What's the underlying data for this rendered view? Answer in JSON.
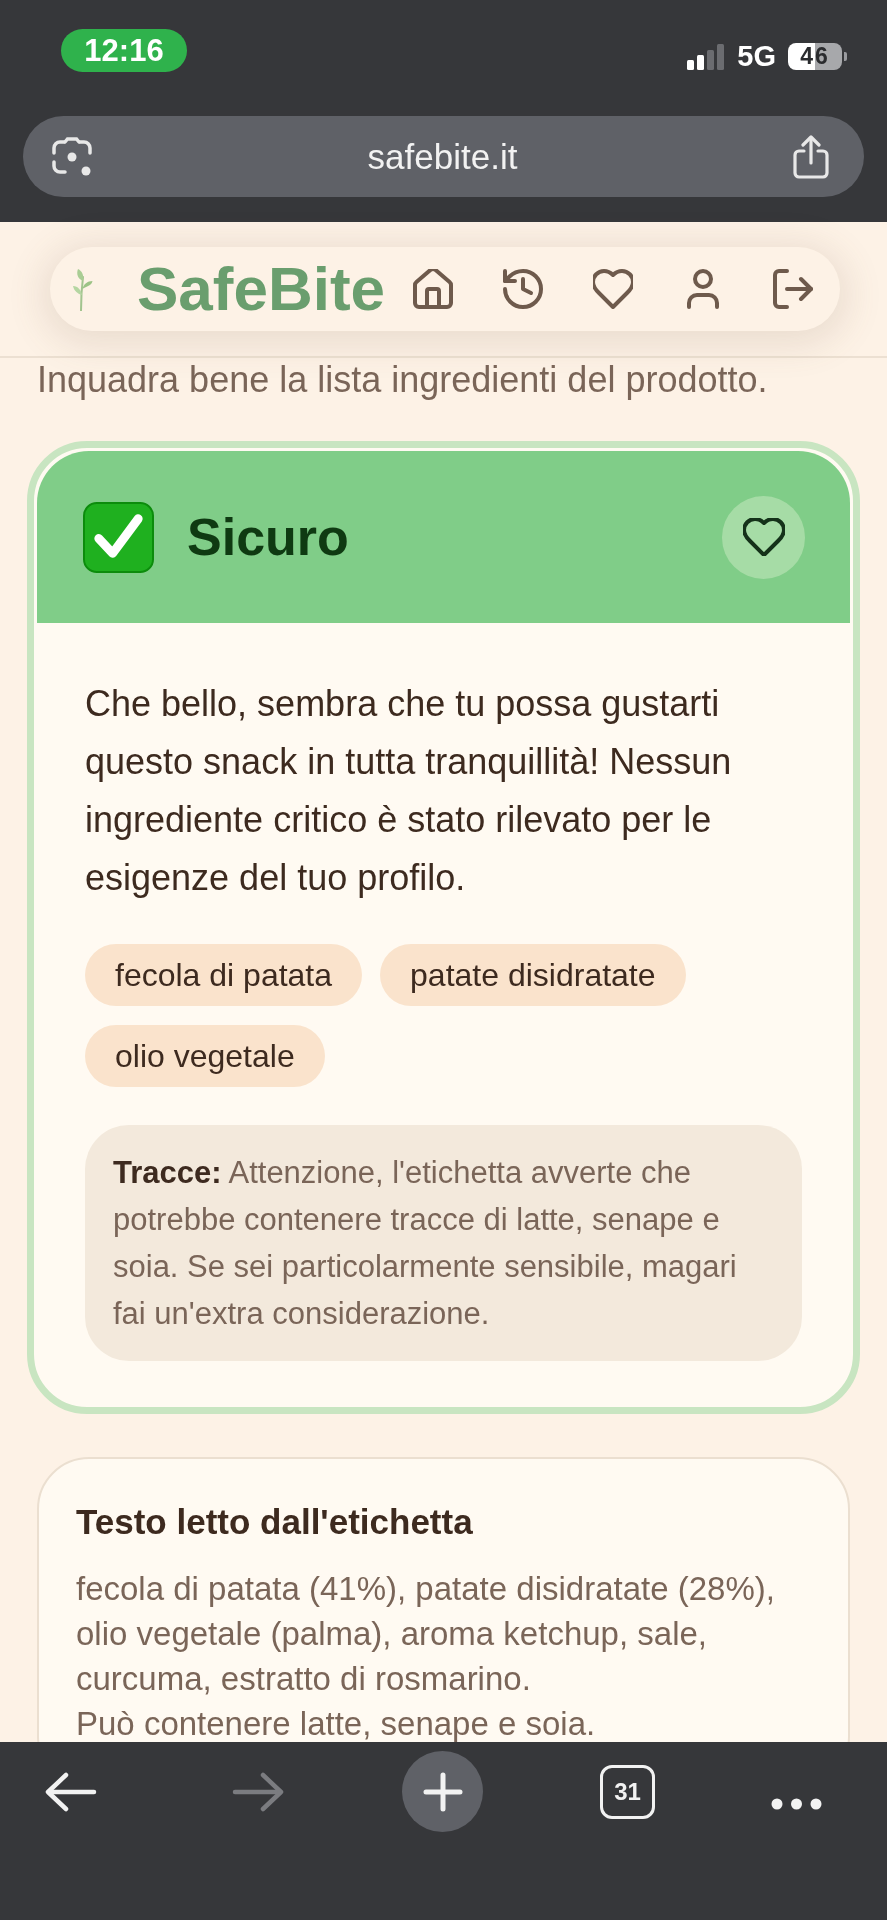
{
  "status_bar": {
    "time": "12:16",
    "network": "5G",
    "battery": "46"
  },
  "address_bar": {
    "url": "safebite.it"
  },
  "header": {
    "brand": "SafeBite"
  },
  "instruction": "Inquadra bene la lista ingredienti del prodotto.",
  "result": {
    "kind": "safe",
    "title": "Sicuro",
    "favorite": false,
    "message": "Che bello, sembra che tu possa gustarti questo snack in tutta tranquillità! Nessun ingrediente critico è stato rilevato per le esigenze del tuo profilo.",
    "ingredients": [
      "fecola di patata",
      "patate disidratate",
      "olio vegetale"
    ],
    "traces": "**Tracce:** Attenzione, l'etichetta avverte che potrebbe contenere tracce di latte, senape e soia. Se sei particolarmente sensibile, magari fai un'extra considerazione."
  },
  "label_text": {
    "title": "Testo letto dall'etichetta",
    "paragraphs": [
      "fecola di patata (41%), patate disidratate (28%), olio vegetale (palma), aroma ketchup, sale, curcuma, estratto di rosmarino.",
      "Può contenere latte, senape e soia."
    ]
  },
  "toolbar": {
    "back_disabled": false,
    "forward_disabled": true,
    "tab_count": "31"
  }
}
